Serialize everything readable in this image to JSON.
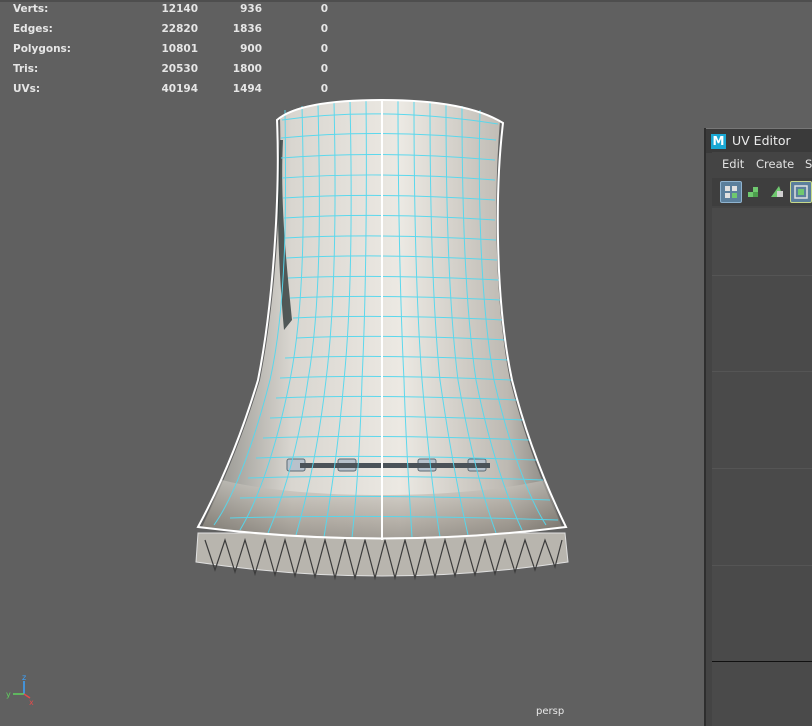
{
  "viewport": {
    "camera_label": "persp",
    "axis_labels": {
      "y": "y",
      "z": "z",
      "x": "x"
    }
  },
  "hud": {
    "rows": [
      {
        "label": "Verts:",
        "v1": "12140",
        "v2": "936",
        "v3": "0"
      },
      {
        "label": "Edges:",
        "v1": "22820",
        "v2": "1836",
        "v3": "0"
      },
      {
        "label": "Polygons:",
        "v1": "10801",
        "v2": "900",
        "v3": "0"
      },
      {
        "label": "Tris:",
        "v1": "20530",
        "v2": "1800",
        "v3": "0"
      },
      {
        "label": "UVs:",
        "v1": "40194",
        "v2": "1494",
        "v3": "0"
      }
    ]
  },
  "uv_editor": {
    "logo": "M",
    "title": "UV Editor",
    "menu": [
      "Edit",
      "Create",
      "Se"
    ]
  },
  "colors": {
    "wireframe": "#55d8ee",
    "selection_outline": "#ffffff",
    "viewport_bg": "#606060",
    "uv_logo": "#1aa8d4"
  }
}
